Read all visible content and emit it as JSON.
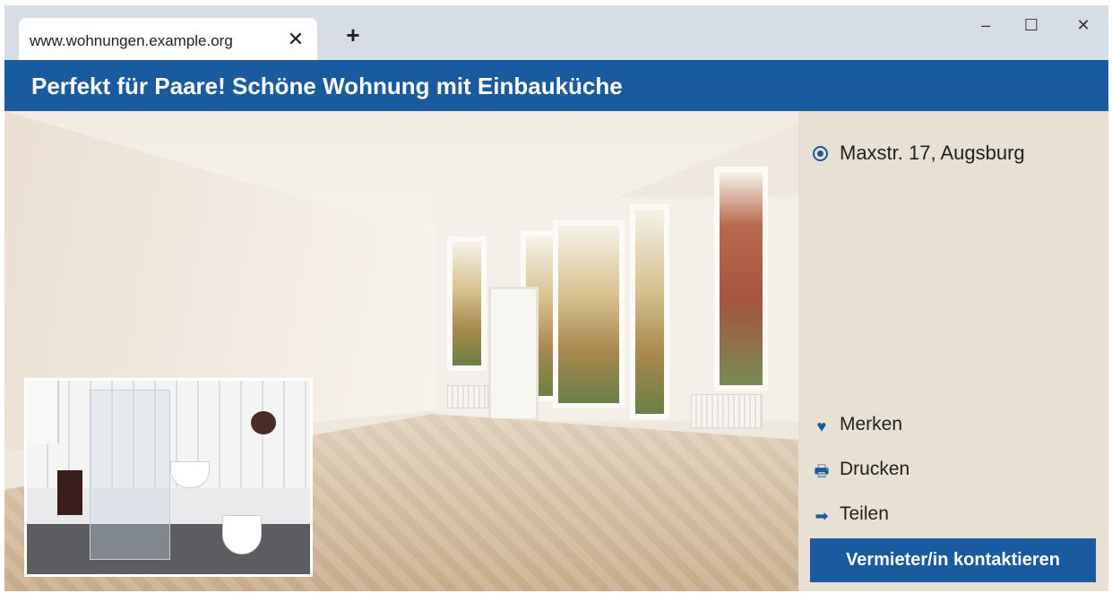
{
  "browser": {
    "tab_title": "www.wohnungen.example.org",
    "tab_close": "✕",
    "new_tab": "+",
    "minimize": "–",
    "maximize": "☐",
    "close": "✕"
  },
  "listing": {
    "title": "Perfekt für Paare! Schöne Wohnung mit Einbauküche",
    "address": "Maxstr. 17, Augsburg"
  },
  "actions": [
    {
      "label": "Merken",
      "icon": "heart-icon",
      "glyph": "♥"
    },
    {
      "label": "Drucken",
      "icon": "printer-icon",
      "glyph": "🖶"
    },
    {
      "label": "Teilen",
      "icon": "arrow-right-icon",
      "glyph": "➡"
    }
  ],
  "contact": {
    "label": "Vermieter/in kontaktieren"
  },
  "colors": {
    "brand_blue": "#1a5a9e",
    "sidebar_bg": "#e8e0d2",
    "tabstrip_bg": "#d7dde4"
  }
}
